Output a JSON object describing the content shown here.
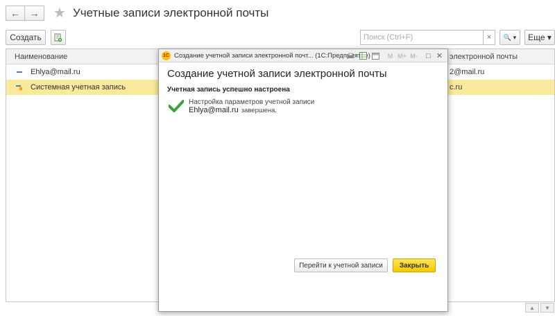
{
  "header": {
    "back_label": "←",
    "forward_label": "→",
    "star_label": "★",
    "title": "Учетные записи электронной почты"
  },
  "toolbar": {
    "create_label": "Создать",
    "search_placeholder": "Поиск (Ctrl+F)",
    "clear_label": "×",
    "search_label": "🔍 ▾",
    "more_label": "Еще ▾"
  },
  "table": {
    "columns": [
      "Наименование",
      "электронной почты"
    ],
    "rows": [
      {
        "name": "Ehlya@mail.ru",
        "email": "2@mail.ru"
      },
      {
        "name": "Системная учетная запись",
        "email": "c.ru"
      }
    ]
  },
  "scroll": {
    "up_label": "▲",
    "down_label": "▼"
  },
  "dialog": {
    "window_title": "Создание учетной записи электронной почт...",
    "app_name": "(1С:Предприятие)",
    "logo_text": "1С",
    "heading": "Создание учетной записи электронной почты",
    "success_label": "Учетная запись успешно настроена",
    "result_line1": "Настройка параметров учетной записи",
    "result_account": "Ehlya@mail.ru",
    "result_suffix": "завершена.",
    "goto_button": "Перейти к учетной записи",
    "close_button": "Закрыть",
    "toolbar_m1": "M",
    "toolbar_m2": "M+",
    "toolbar_m3": "M-",
    "ctrl_maximize": "□",
    "ctrl_close": "✕",
    "accent_color": "#f5c800",
    "check_color": "#3aa33a"
  }
}
